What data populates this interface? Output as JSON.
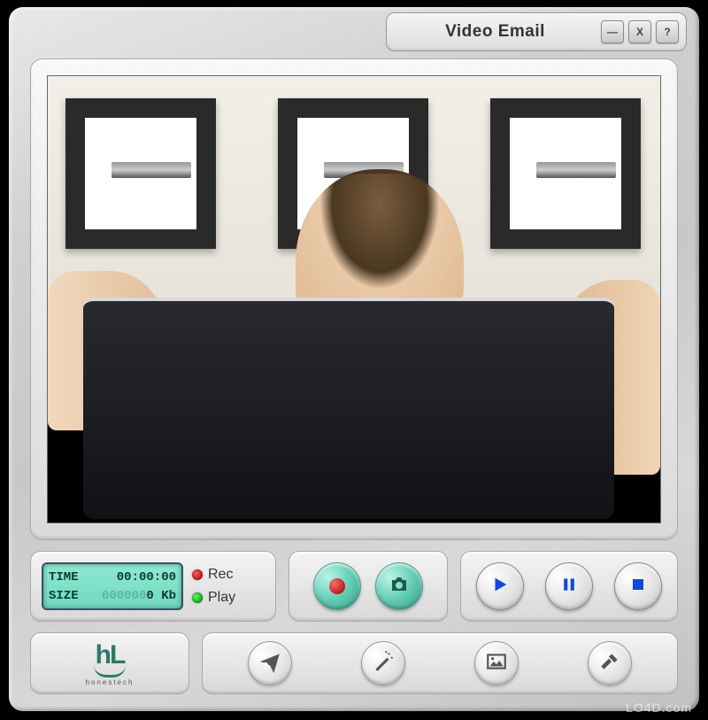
{
  "window": {
    "title": "Video Email",
    "minimize_label": "—",
    "close_label": "X",
    "help_label": "?"
  },
  "status": {
    "time_label": "TIME",
    "time_value": "00:00:00",
    "size_label": "SIZE",
    "size_padding": "000000",
    "size_value": "0 Kb",
    "rec_label": "Rec",
    "play_label": "Play"
  },
  "logo": {
    "text": "hL",
    "subtext": "honestech"
  },
  "icons": {
    "record": "record-icon",
    "camera": "camera-icon",
    "play": "play-icon",
    "pause": "pause-icon",
    "stop": "stop-icon",
    "send": "send-icon",
    "effects": "wand-icon",
    "image": "picture-icon",
    "settings": "hammer-icon"
  },
  "watermark": "LO4D.com"
}
